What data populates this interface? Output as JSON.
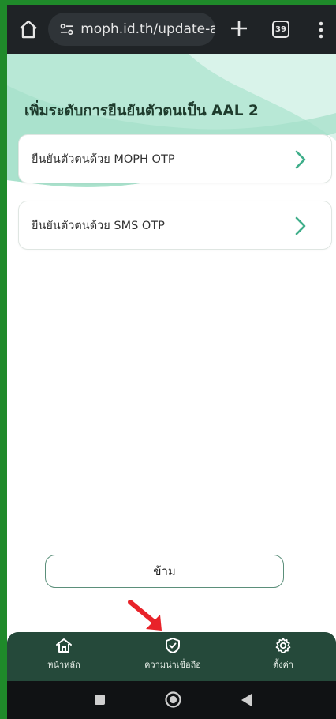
{
  "browser": {
    "url": "moph.id.th/update-aal",
    "tab_count": "39",
    "icons": [
      "home-icon",
      "site-settings-icon",
      "new-tab-icon",
      "tab-switcher-icon",
      "more-menu-icon"
    ]
  },
  "page": {
    "title": "เพิ่มระดับการยืนยันตัวตนเป็น AAL 2",
    "options": [
      {
        "label": "ยืนยันตัวตนด้วย MOPH OTP"
      },
      {
        "label": "ยืนยันตัวตนด้วย SMS OTP"
      }
    ],
    "skip_label": "ข้าม"
  },
  "bottom_nav": {
    "items": [
      {
        "label": "หน้าหลัก",
        "icon": "home-icon"
      },
      {
        "label": "ความน่าเชื่อถือ",
        "icon": "shield-check-icon"
      },
      {
        "label": "ตั้งค่า",
        "icon": "gear-icon"
      }
    ]
  },
  "colors": {
    "accent": "#3fae8a",
    "nav_bg": "#25493a",
    "annotation_arrow": "#e8232a",
    "frame": "#1f8a2a"
  }
}
